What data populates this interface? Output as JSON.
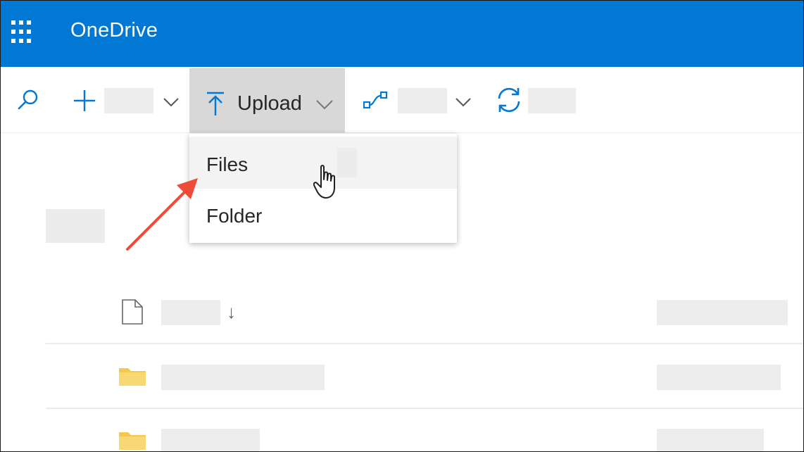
{
  "header": {
    "app_title": "OneDrive",
    "brand_color": "#0078d4",
    "launcher_icon": "app-launcher-waffle-icon"
  },
  "commandbar": {
    "search_icon": "search-icon",
    "new_icon": "plus-icon",
    "upload_label": "Upload",
    "upload_icon": "upload-arrow-icon",
    "share_icon": "link-flow-icon",
    "sync_icon": "sync-icon"
  },
  "upload_menu": {
    "items": [
      {
        "label": "Files",
        "hovered": true
      },
      {
        "label": "Folder",
        "hovered": false
      }
    ]
  },
  "file_list": {
    "sort_indicator": "↓",
    "header_icon": "document-icon",
    "row_icon": "folder-icon"
  },
  "annotation": {
    "color": "#f04a3a",
    "points_to": "Files"
  }
}
